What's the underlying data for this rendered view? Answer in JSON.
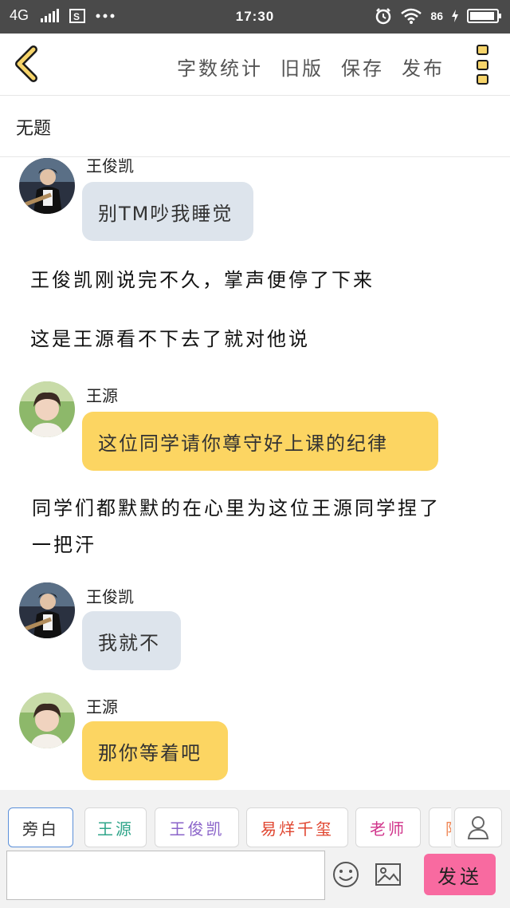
{
  "status_bar": {
    "network": "4G",
    "time": "17:30",
    "battery": "86"
  },
  "toolbar": {
    "word_count": "字数统计",
    "old_version": "旧版",
    "save": "保存",
    "publish": "发布"
  },
  "doc": {
    "title": "无题"
  },
  "messages": [
    {
      "speaker": "王俊凯",
      "text": "别TM吵我睡觉"
    },
    {
      "narration": "王俊凯刚说完不久，掌声便停了下来"
    },
    {
      "narration": "这是王源看不下去了就对他说"
    },
    {
      "speaker": "王源",
      "text": "这位同学请你尊守好上课的纪律"
    },
    {
      "narration_line1": "同学们都默默的在心里为这位王源同学捏了",
      "narration_line2": "一把汗"
    },
    {
      "speaker": "王俊凯",
      "text": "我就不"
    },
    {
      "speaker": "王源",
      "text": "那你等着吧"
    }
  ],
  "roles": [
    {
      "label": "旁白",
      "color": "#333333"
    },
    {
      "label": "王源",
      "color": "#2fa58a"
    },
    {
      "label": "王俊凯",
      "color": "#8a63c9"
    },
    {
      "label": "易烊千玺",
      "color": "#e0452f"
    },
    {
      "label": "老师",
      "color": "#d0338a"
    },
    {
      "label": "陌",
      "color": "#f08a5a"
    }
  ],
  "composer": {
    "send": "发送",
    "input_value": ""
  },
  "icons": {
    "back": "chevron-left-icon",
    "more": "more-vertical-icon",
    "emoji": "smiley-icon",
    "image": "image-icon",
    "person": "person-icon"
  }
}
